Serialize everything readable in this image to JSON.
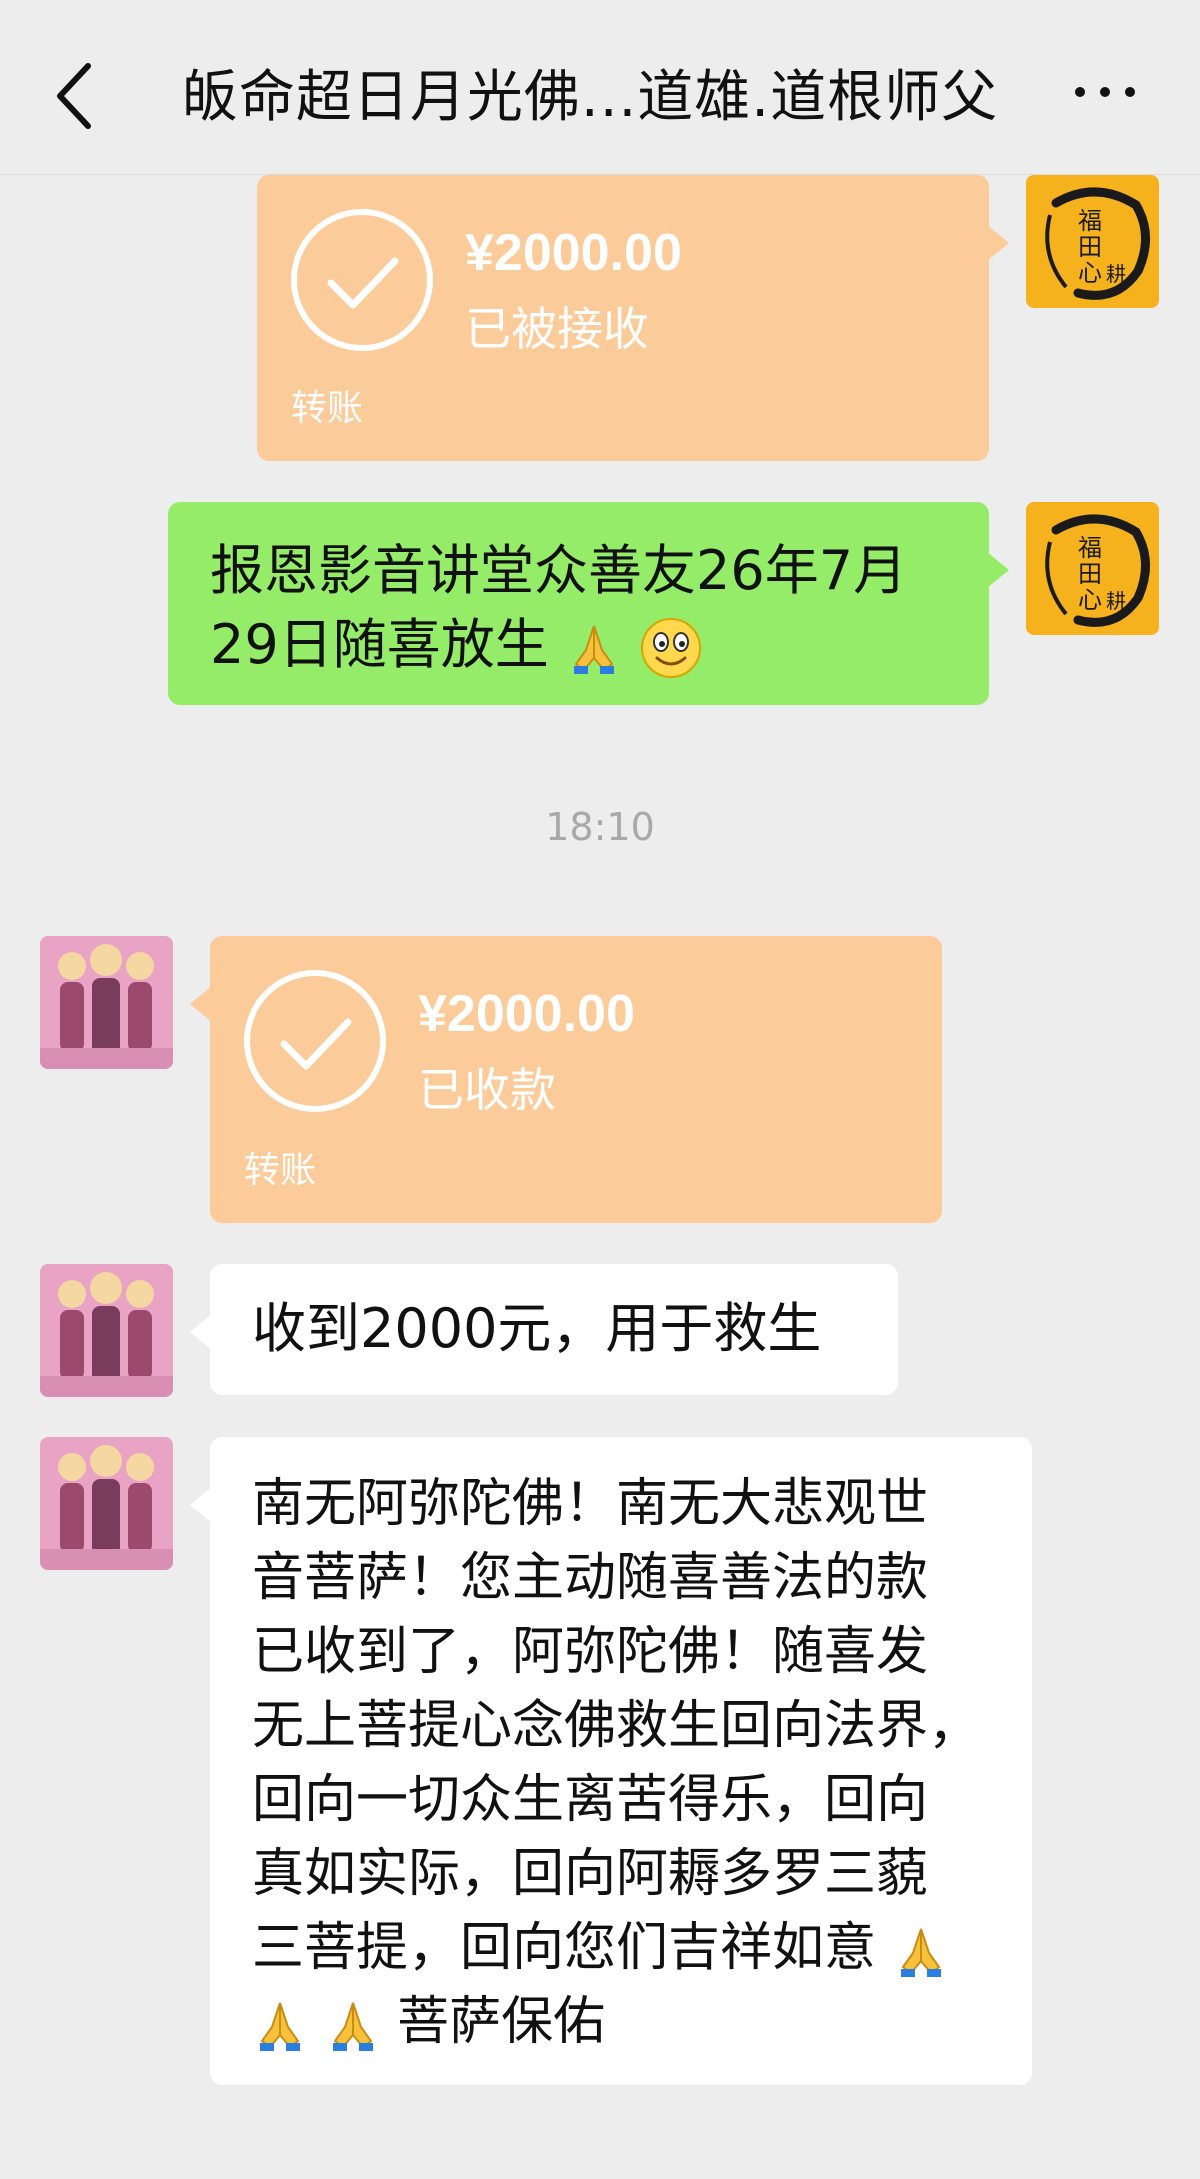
{
  "header": {
    "title": "皈命超日月光佛...道雄.道根师父",
    "back_icon": "chevron-left-icon",
    "more_icon": "more-dots-icon"
  },
  "messages": [
    {
      "side": "right",
      "type": "transfer",
      "amount": "¥2000.00",
      "status": "已被接收",
      "label": "转账"
    },
    {
      "side": "right",
      "type": "text",
      "text": "报恩影音讲堂众善友26年7月29日随喜放生",
      "emojis": [
        "praying-hands",
        "smiling-face"
      ]
    },
    {
      "side": "left",
      "type": "transfer",
      "amount": "¥2000.00",
      "status": "已收款",
      "label": "转账"
    },
    {
      "side": "left",
      "type": "text",
      "text": "收到2000元，用于救生"
    },
    {
      "side": "left",
      "type": "text",
      "lines": [
        "南无阿弥陀佛！南无大悲观世",
        "音菩萨！您主动随喜善法的款",
        "已收到了，阿弥陀佛！随喜发",
        "无上菩提心念佛救生回向法界，",
        "回向一切众生离苦得乐，回向",
        "真如实际，回向阿耨多罗三藐",
        "三菩提，回向您们吉祥如意",
        "菩萨保佑"
      ]
    }
  ],
  "timestamp": "18:10",
  "avatar_right_text": "福田心耕",
  "colors": {
    "background": "#ededed",
    "transfer_bubble": "#fbcc9a",
    "sent_bubble": "#95ec69",
    "received_bubble": "#ffffff"
  }
}
